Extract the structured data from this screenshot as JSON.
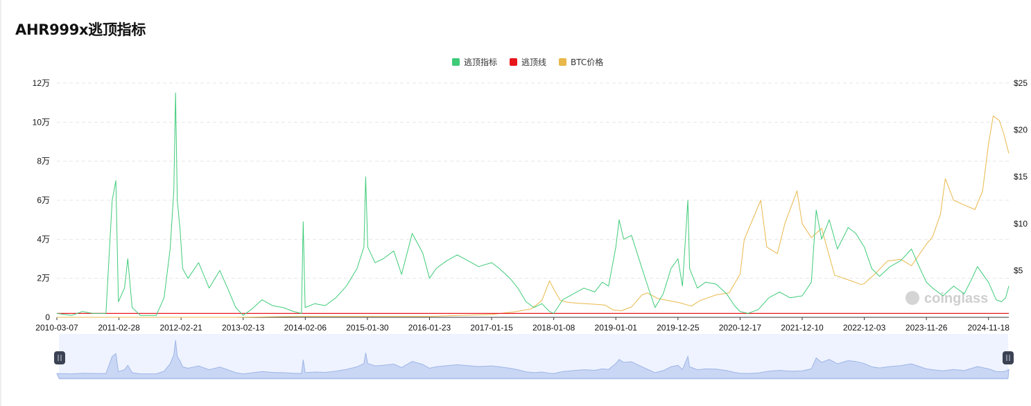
{
  "title": "AHR999x逃顶指标",
  "legend": [
    {
      "label": "逃顶指标",
      "color": "#3ecb78"
    },
    {
      "label": "逃顶线",
      "color": "#e8161b"
    },
    {
      "label": "BTC价格",
      "color": "#e8b84b"
    }
  ],
  "watermark": "coinglass",
  "chart_data": {
    "type": "line",
    "left_axis": {
      "ticks": [
        "0",
        "2万",
        "4万",
        "6万",
        "8万",
        "10万",
        "12万"
      ],
      "range": [
        0,
        12
      ]
    },
    "right_axis": {
      "ticks": [
        "$5",
        "$10",
        "$15",
        "$20",
        "$25"
      ],
      "range": [
        0,
        25
      ]
    },
    "x_ticks": [
      "2010-03-07",
      "2011-02-28",
      "2012-02-21",
      "2013-02-13",
      "2014-02-06",
      "2015-01-30",
      "2016-01-23",
      "2017-01-15",
      "2018-01-08",
      "2019-01-01",
      "2019-12-25",
      "2020-12-17",
      "2021-12-10",
      "2022-12-03",
      "2023-11-26",
      "2024-11-18"
    ],
    "x_range": [
      "2010-03-07",
      "2025-03-15"
    ],
    "grid": "horizontal dashed",
    "legend_position": "top-center",
    "series": [
      {
        "name": "逃顶指标",
        "axis": "left",
        "color": "#3ecb78",
        "points": [
          [
            "2010-03-07",
            0.2
          ],
          [
            "2010-06-01",
            0.1
          ],
          [
            "2010-08-01",
            0.3
          ],
          [
            "2010-10-01",
            0.2
          ],
          [
            "2010-12-15",
            0.2
          ],
          [
            "2011-01-20",
            6.0
          ],
          [
            "2011-02-10",
            7.0
          ],
          [
            "2011-02-25",
            0.8
          ],
          [
            "2011-04-01",
            1.5
          ],
          [
            "2011-04-20",
            3.0
          ],
          [
            "2011-05-15",
            0.5
          ],
          [
            "2011-07-01",
            0.1
          ],
          [
            "2011-10-01",
            0.1
          ],
          [
            "2011-11-15",
            1.0
          ],
          [
            "2011-12-20",
            3.5
          ],
          [
            "2012-01-10",
            6.5
          ],
          [
            "2012-01-20",
            11.5
          ],
          [
            "2012-01-30",
            6.0
          ],
          [
            "2012-02-15",
            4.5
          ],
          [
            "2012-03-01",
            2.5
          ],
          [
            "2012-04-01",
            2.0
          ],
          [
            "2012-06-01",
            2.8
          ],
          [
            "2012-08-01",
            1.5
          ],
          [
            "2012-10-01",
            2.4
          ],
          [
            "2012-11-15",
            1.5
          ],
          [
            "2013-01-01",
            0.5
          ],
          [
            "2013-02-13",
            0.1
          ],
          [
            "2013-04-01",
            0.4
          ],
          [
            "2013-06-01",
            0.9
          ],
          [
            "2013-08-01",
            0.6
          ],
          [
            "2013-10-01",
            0.5
          ],
          [
            "2013-12-01",
            0.3
          ],
          [
            "2014-01-15",
            0.2
          ],
          [
            "2014-01-25",
            4.9
          ],
          [
            "2014-02-05",
            0.5
          ],
          [
            "2014-04-01",
            0.7
          ],
          [
            "2014-06-01",
            0.6
          ],
          [
            "2014-08-01",
            1.0
          ],
          [
            "2014-10-01",
            1.6
          ],
          [
            "2014-12-01",
            2.5
          ],
          [
            "2015-01-10",
            3.6
          ],
          [
            "2015-01-20",
            7.2
          ],
          [
            "2015-02-01",
            3.6
          ],
          [
            "2015-03-15",
            2.8
          ],
          [
            "2015-05-01",
            3.0
          ],
          [
            "2015-07-01",
            3.4
          ],
          [
            "2015-08-15",
            2.2
          ],
          [
            "2015-10-15",
            4.3
          ],
          [
            "2015-12-15",
            3.3
          ],
          [
            "2016-01-23",
            2.0
          ],
          [
            "2016-03-01",
            2.5
          ],
          [
            "2016-05-01",
            2.9
          ],
          [
            "2016-07-01",
            3.2
          ],
          [
            "2016-09-01",
            2.9
          ],
          [
            "2016-11-01",
            2.6
          ],
          [
            "2017-01-15",
            2.8
          ],
          [
            "2017-03-01",
            2.5
          ],
          [
            "2017-05-01",
            2.0
          ],
          [
            "2017-06-15",
            1.5
          ],
          [
            "2017-08-01",
            0.8
          ],
          [
            "2017-09-15",
            0.5
          ],
          [
            "2017-11-01",
            0.7
          ],
          [
            "2017-12-15",
            0.3
          ],
          [
            "2018-01-08",
            0.2
          ],
          [
            "2018-03-01",
            0.9
          ],
          [
            "2018-05-01",
            1.2
          ],
          [
            "2018-07-01",
            1.5
          ],
          [
            "2018-09-01",
            1.3
          ],
          [
            "2018-10-15",
            1.8
          ],
          [
            "2018-11-20",
            1.6
          ],
          [
            "2018-12-15",
            2.8
          ],
          [
            "2019-01-01",
            3.6
          ],
          [
            "2019-01-20",
            5.0
          ],
          [
            "2019-02-15",
            4.0
          ],
          [
            "2019-04-01",
            4.2
          ],
          [
            "2019-06-01",
            2.5
          ],
          [
            "2019-07-15",
            1.3
          ],
          [
            "2019-08-15",
            0.5
          ],
          [
            "2019-10-01",
            1.2
          ],
          [
            "2019-11-15",
            2.5
          ],
          [
            "2019-12-25",
            3.0
          ],
          [
            "2020-01-20",
            1.6
          ],
          [
            "2020-02-20",
            6.0
          ],
          [
            "2020-03-01",
            2.5
          ],
          [
            "2020-04-15",
            1.5
          ],
          [
            "2020-06-01",
            1.8
          ],
          [
            "2020-08-01",
            1.7
          ],
          [
            "2020-10-01",
            1.2
          ],
          [
            "2020-11-15",
            0.6
          ],
          [
            "2020-12-17",
            0.3
          ],
          [
            "2021-02-01",
            0.2
          ],
          [
            "2021-04-01",
            0.4
          ],
          [
            "2021-06-01",
            1.0
          ],
          [
            "2021-08-01",
            1.3
          ],
          [
            "2021-10-01",
            1.0
          ],
          [
            "2021-12-10",
            1.1
          ],
          [
            "2022-02-01",
            1.8
          ],
          [
            "2022-03-01",
            5.5
          ],
          [
            "2022-04-01",
            4.0
          ],
          [
            "2022-05-15",
            5.0
          ],
          [
            "2022-07-01",
            3.5
          ],
          [
            "2022-09-01",
            4.6
          ],
          [
            "2022-10-15",
            4.3
          ],
          [
            "2022-12-03",
            3.6
          ],
          [
            "2023-01-15",
            2.5
          ],
          [
            "2023-03-01",
            2.1
          ],
          [
            "2023-05-01",
            2.6
          ],
          [
            "2023-07-01",
            2.9
          ],
          [
            "2023-09-01",
            3.5
          ],
          [
            "2023-10-20",
            2.5
          ],
          [
            "2023-11-26",
            1.8
          ],
          [
            "2024-01-01",
            1.5
          ],
          [
            "2024-03-01",
            1.1
          ],
          [
            "2024-05-01",
            1.6
          ],
          [
            "2024-07-01",
            1.2
          ],
          [
            "2024-08-15",
            2.0
          ],
          [
            "2024-09-15",
            2.6
          ],
          [
            "2024-11-01",
            2.0
          ],
          [
            "2024-11-18",
            1.8
          ],
          [
            "2025-01-01",
            0.9
          ],
          [
            "2025-02-01",
            0.8
          ],
          [
            "2025-02-25",
            1.0
          ],
          [
            "2025-03-15",
            1.6
          ]
        ]
      },
      {
        "name": "逃顶线",
        "axis": "left",
        "color": "#e8161b",
        "points": [
          [
            "2010-03-07",
            0.2
          ],
          [
            "2025-03-15",
            0.2
          ]
        ]
      },
      {
        "name": "BTC价格",
        "axis": "right",
        "color": "#e8b84b",
        "points": [
          [
            "2010-03-07",
            0.0
          ],
          [
            "2013-01-01",
            0.0
          ],
          [
            "2014-02-06",
            0.1
          ],
          [
            "2015-01-30",
            0.1
          ],
          [
            "2016-01-23",
            0.1
          ],
          [
            "2017-01-15",
            0.3
          ],
          [
            "2017-06-01",
            0.6
          ],
          [
            "2017-09-01",
            0.9
          ],
          [
            "2017-11-01",
            1.8
          ],
          [
            "2017-12-15",
            3.9
          ],
          [
            "2018-01-08",
            3.0
          ],
          [
            "2018-02-15",
            1.8
          ],
          [
            "2018-04-01",
            1.6
          ],
          [
            "2018-06-01",
            1.5
          ],
          [
            "2018-09-01",
            1.4
          ],
          [
            "2018-11-01",
            1.3
          ],
          [
            "2018-12-15",
            0.8
          ],
          [
            "2019-02-01",
            0.7
          ],
          [
            "2019-04-01",
            1.1
          ],
          [
            "2019-06-01",
            2.4
          ],
          [
            "2019-07-01",
            2.6
          ],
          [
            "2019-09-01",
            2.0
          ],
          [
            "2019-12-25",
            1.6
          ],
          [
            "2020-03-12",
            1.2
          ],
          [
            "2020-05-01",
            1.8
          ],
          [
            "2020-08-01",
            2.4
          ],
          [
            "2020-10-15",
            2.6
          ],
          [
            "2020-12-17",
            4.6
          ],
          [
            "2021-01-10",
            8.3
          ],
          [
            "2021-03-01",
            10.5
          ],
          [
            "2021-04-15",
            12.5
          ],
          [
            "2021-05-20",
            7.5
          ],
          [
            "2021-07-20",
            6.8
          ],
          [
            "2021-09-01",
            10.0
          ],
          [
            "2021-11-10",
            13.5
          ],
          [
            "2021-12-10",
            10.0
          ],
          [
            "2022-02-01",
            8.5
          ],
          [
            "2022-04-01",
            9.5
          ],
          [
            "2022-06-15",
            4.5
          ],
          [
            "2022-09-01",
            4.0
          ],
          [
            "2022-11-15",
            3.5
          ],
          [
            "2022-12-03",
            3.6
          ],
          [
            "2023-02-01",
            4.6
          ],
          [
            "2023-04-15",
            6.0
          ],
          [
            "2023-07-01",
            6.2
          ],
          [
            "2023-09-01",
            5.5
          ],
          [
            "2023-11-26",
            7.8
          ],
          [
            "2024-01-01",
            8.6
          ],
          [
            "2024-02-15",
            11.0
          ],
          [
            "2024-03-14",
            14.8
          ],
          [
            "2024-05-01",
            12.5
          ],
          [
            "2024-07-01",
            12.0
          ],
          [
            "2024-09-01",
            11.5
          ],
          [
            "2024-10-15",
            13.5
          ],
          [
            "2024-11-18",
            18.5
          ],
          [
            "2024-12-15",
            21.5
          ],
          [
            "2025-01-20",
            21.0
          ],
          [
            "2025-02-15",
            19.5
          ],
          [
            "2025-03-15",
            17.5
          ]
        ]
      }
    ]
  }
}
